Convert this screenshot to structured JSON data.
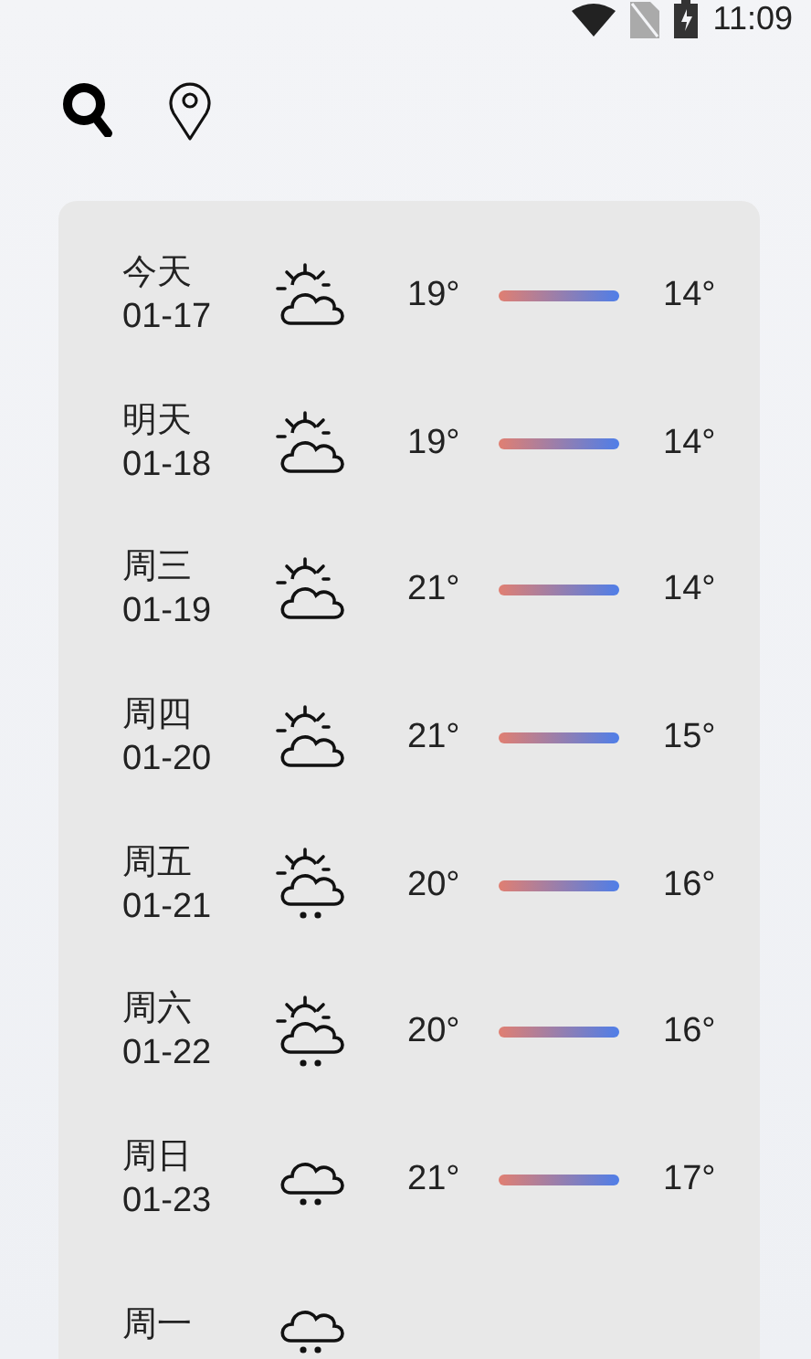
{
  "status_bar": {
    "time": "11:09"
  },
  "days": [
    {
      "day": "今天",
      "date": "01-17",
      "kind": "sun_cloud",
      "high": "19°",
      "low": "14°"
    },
    {
      "day": "明天",
      "date": "01-18",
      "kind": "sun_cloud",
      "high": "19°",
      "low": "14°"
    },
    {
      "day": "周三",
      "date": "01-19",
      "kind": "sun_cloud",
      "high": "21°",
      "low": "14°"
    },
    {
      "day": "周四",
      "date": "01-20",
      "kind": "sun_cloud",
      "high": "21°",
      "low": "15°"
    },
    {
      "day": "周五",
      "date": "01-21",
      "kind": "sun_rain",
      "high": "20°",
      "low": "16°"
    },
    {
      "day": "周六",
      "date": "01-22",
      "kind": "sun_rain",
      "high": "20°",
      "low": "16°"
    },
    {
      "day": "周日",
      "date": "01-23",
      "kind": "rain",
      "high": "21°",
      "low": "17°"
    },
    {
      "day": "周一",
      "kind": "rain"
    }
  ]
}
